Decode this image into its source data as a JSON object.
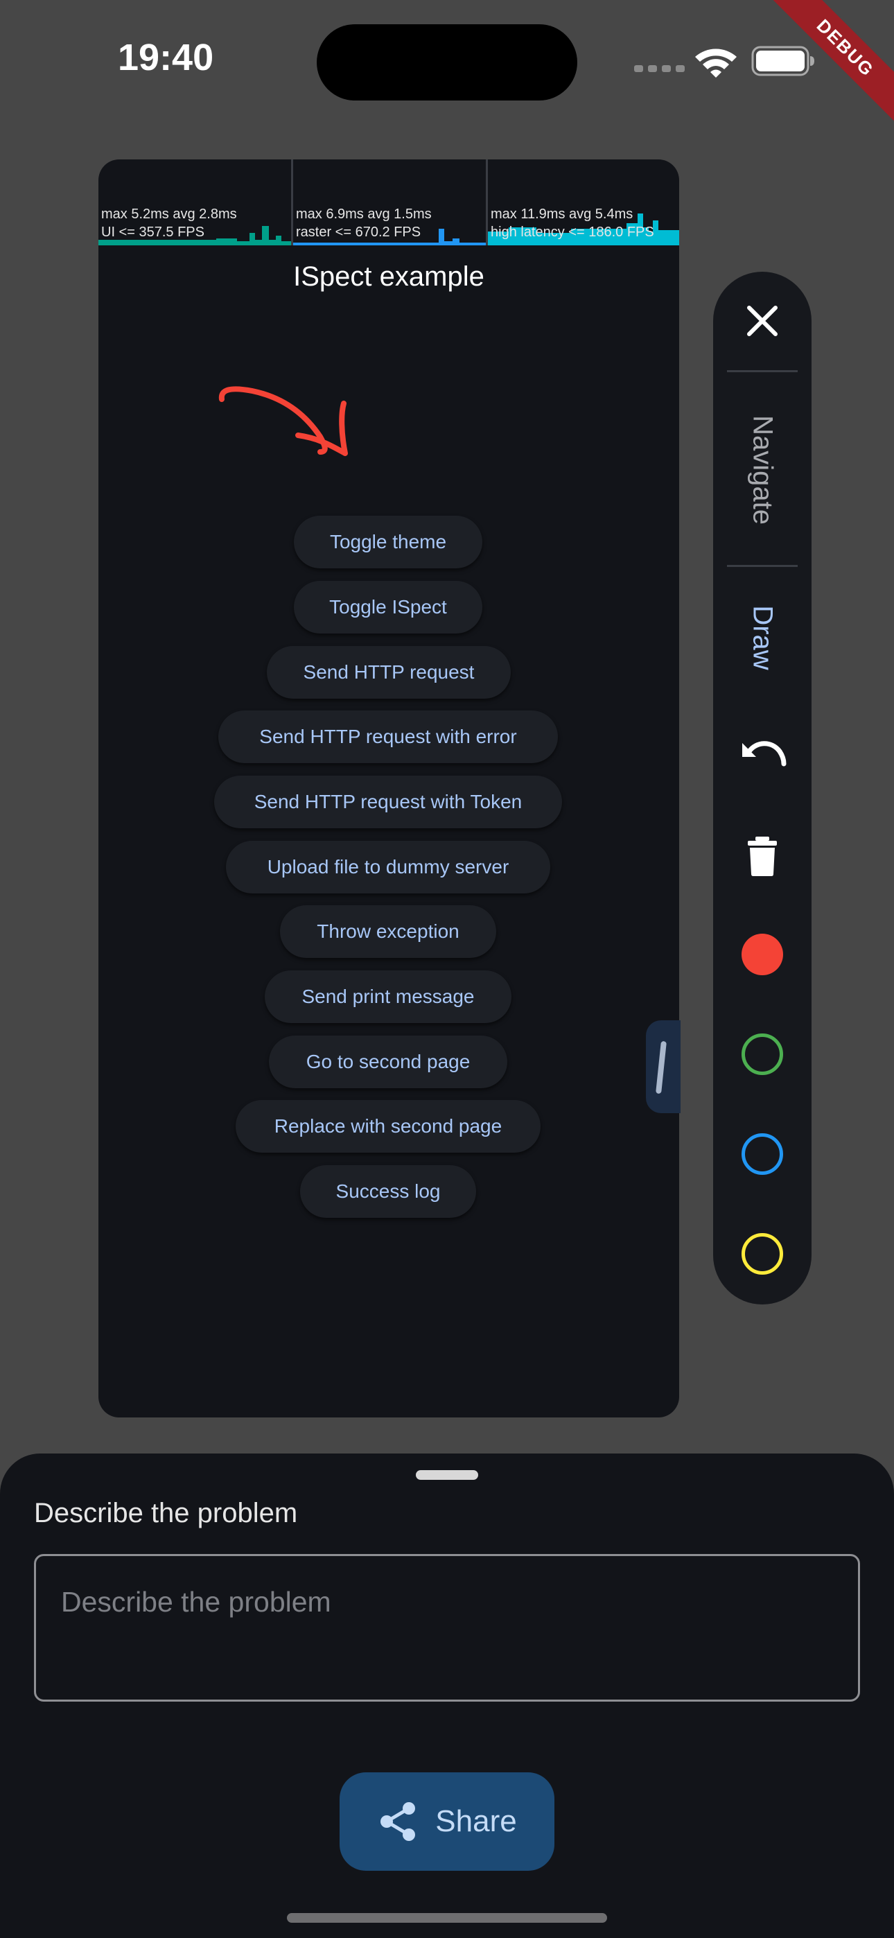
{
  "status_bar": {
    "time": "19:40"
  },
  "debug_banner": "DEBUG",
  "perf_overlay": [
    {
      "line1": "max 5.2ms avg 2.8ms",
      "line2": "UI <= 357.5 FPS",
      "color": "#00a08a"
    },
    {
      "line1": "max 6.9ms avg 1.5ms",
      "line2": "raster <= 670.2 FPS",
      "color": "#2196f3"
    },
    {
      "line1": "max 11.9ms avg 5.4ms",
      "line2": "high latency <= 186.0 FPS",
      "color": "#00bcd4"
    }
  ],
  "preview": {
    "title": "ISpect example",
    "buttons": [
      "Toggle theme",
      "Toggle ISpect",
      "Send HTTP request",
      "Send HTTP request with error",
      "Send HTTP request with Token",
      "Upload file to dummy server",
      "Throw exception",
      "Send print message",
      "Go to second page",
      "Replace with second page",
      "Success log"
    ]
  },
  "toolbar": {
    "close_icon": "close-icon",
    "navigate_label": "Navigate",
    "draw_label": "Draw",
    "undo_icon": "undo-icon",
    "delete_icon": "trash-icon",
    "colors": [
      {
        "name": "red",
        "value": "#f44336",
        "selected": true
      },
      {
        "name": "green",
        "value": "#4caf50",
        "selected": false
      },
      {
        "name": "blue",
        "value": "#2196f3",
        "selected": false
      },
      {
        "name": "yellow",
        "value": "#ffeb3b",
        "selected": false
      }
    ]
  },
  "sheet": {
    "label": "Describe the problem",
    "input_placeholder": "Describe the problem",
    "input_value": "",
    "share_label": "Share"
  },
  "colors": {
    "background": "#474747",
    "surface": "#121419",
    "accent": "#a8c7f7",
    "annotation": "#f44336"
  }
}
